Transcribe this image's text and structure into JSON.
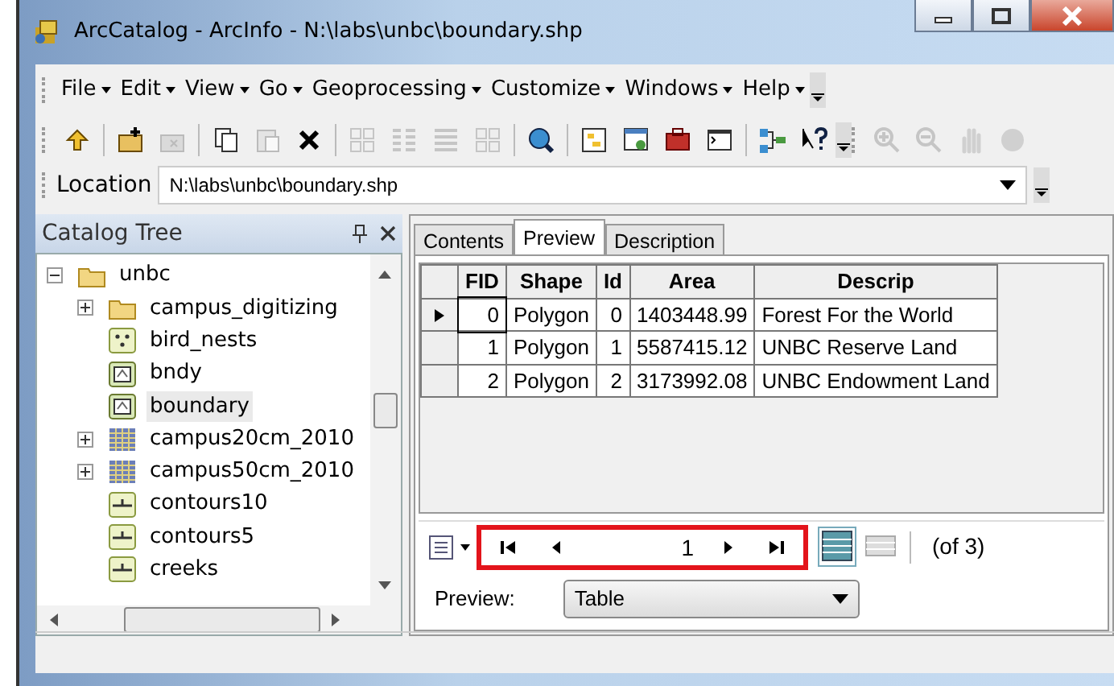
{
  "window": {
    "title": "ArcCatalog - ArcInfo - N:\\labs\\unbc\\boundary.shp"
  },
  "menu": [
    {
      "label": "File"
    },
    {
      "label": "Edit"
    },
    {
      "label": "View"
    },
    {
      "label": "Go"
    },
    {
      "label": "Geoprocessing"
    },
    {
      "label": "Customize"
    },
    {
      "label": "Windows"
    },
    {
      "label": "Help"
    }
  ],
  "toolbar": [
    {
      "kind": "up",
      "disabled": false
    },
    {
      "kind": "separator"
    },
    {
      "kind": "connect",
      "disabled": false
    },
    {
      "kind": "disconnect",
      "disabled": true
    },
    {
      "kind": "separator"
    },
    {
      "kind": "copy",
      "disabled": false
    },
    {
      "kind": "paste",
      "disabled": true
    },
    {
      "kind": "delete",
      "disabled": false
    },
    {
      "kind": "separator"
    },
    {
      "kind": "large-icons",
      "disabled": true
    },
    {
      "kind": "list",
      "disabled": true
    },
    {
      "kind": "details",
      "disabled": true
    },
    {
      "kind": "thumbnails",
      "disabled": true
    },
    {
      "kind": "separator"
    },
    {
      "kind": "search",
      "disabled": false
    },
    {
      "kind": "separator"
    },
    {
      "kind": "catalog",
      "disabled": false
    },
    {
      "kind": "arcmap",
      "disabled": false
    },
    {
      "kind": "toolbox",
      "disabled": false
    },
    {
      "kind": "command",
      "disabled": false
    },
    {
      "kind": "separator"
    },
    {
      "kind": "model",
      "disabled": false
    },
    {
      "kind": "whats-this",
      "disabled": false
    }
  ],
  "toolbar2": [
    {
      "kind": "zoom-in",
      "disabled": true
    },
    {
      "kind": "zoom-out",
      "disabled": true
    },
    {
      "kind": "pan",
      "disabled": true
    },
    {
      "kind": "globe",
      "disabled": true
    }
  ],
  "location": {
    "label": "Location",
    "value": "N:\\labs\\unbc\\boundary.shp"
  },
  "catalog_tree": {
    "title": "Catalog Tree",
    "items": [
      {
        "label": "unbc",
        "kind": "folder",
        "expanded": true,
        "selected": false,
        "children": [
          {
            "label": "campus_digitizing",
            "kind": "folder",
            "expanded": false,
            "selected": false
          },
          {
            "label": "bird_nests",
            "kind": "point",
            "selected": false
          },
          {
            "label": "bndy",
            "kind": "polygon",
            "selected": false
          },
          {
            "label": "boundary",
            "kind": "polygon",
            "selected": true
          },
          {
            "label": "campus20cm_2010",
            "kind": "raster",
            "expanded": false,
            "selected": false
          },
          {
            "label": "campus50cm_2010",
            "kind": "raster",
            "expanded": false,
            "selected": false
          },
          {
            "label": "contours10",
            "kind": "line",
            "selected": false
          },
          {
            "label": "contours5",
            "kind": "line",
            "selected": false
          },
          {
            "label": "creeks",
            "kind": "line",
            "selected": false
          }
        ]
      }
    ]
  },
  "tabs": [
    {
      "label": "Contents",
      "selected": false
    },
    {
      "label": "Preview",
      "selected": true
    },
    {
      "label": "Description",
      "selected": false
    }
  ],
  "table": {
    "columns": [
      "FID",
      "Shape",
      "Id",
      "Area",
      "Descrip"
    ],
    "rows": [
      {
        "current": true,
        "cells": [
          "0",
          "Polygon",
          "0",
          "1403448.99",
          "Forest For the World"
        ]
      },
      {
        "current": false,
        "cells": [
          "1",
          "Polygon",
          "1",
          "5587415.12",
          "UNBC Reserve Land"
        ]
      },
      {
        "current": false,
        "cells": [
          "2",
          "Polygon",
          "2",
          "3173992.08",
          "UNBC Endowment Land"
        ]
      }
    ]
  },
  "navigator": {
    "record": "1",
    "count": "(of 3)",
    "highlighted": true
  },
  "preview": {
    "label": "Preview:",
    "value": "Table"
  }
}
